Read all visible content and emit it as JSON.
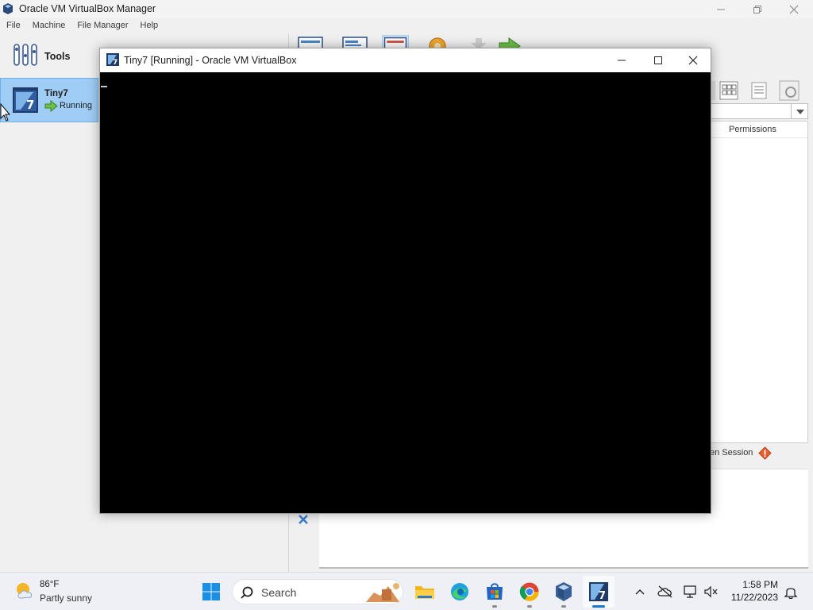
{
  "manager": {
    "title": "Oracle VM VirtualBox Manager",
    "menu": [
      "File",
      "Machine",
      "File Manager",
      "Help"
    ],
    "tools_label": "Tools",
    "vm": {
      "name": "Tiny7",
      "status": "Running"
    },
    "permissions_header": "Permissions",
    "session_label": "en Session"
  },
  "vm_window": {
    "title": "Tiny7 [Running] - Oracle VM VirtualBox"
  },
  "taskbar": {
    "weather": {
      "temp": "86°F",
      "condition": "Partly sunny"
    },
    "search_label": "Search",
    "clock": {
      "time": "1:58 PM",
      "date": "11/22/2023"
    }
  },
  "colors": {
    "selection": "#9fcdf5",
    "vm_screen": "#000000",
    "taskbar": "#eef0f5",
    "accent": "#1976d2"
  }
}
